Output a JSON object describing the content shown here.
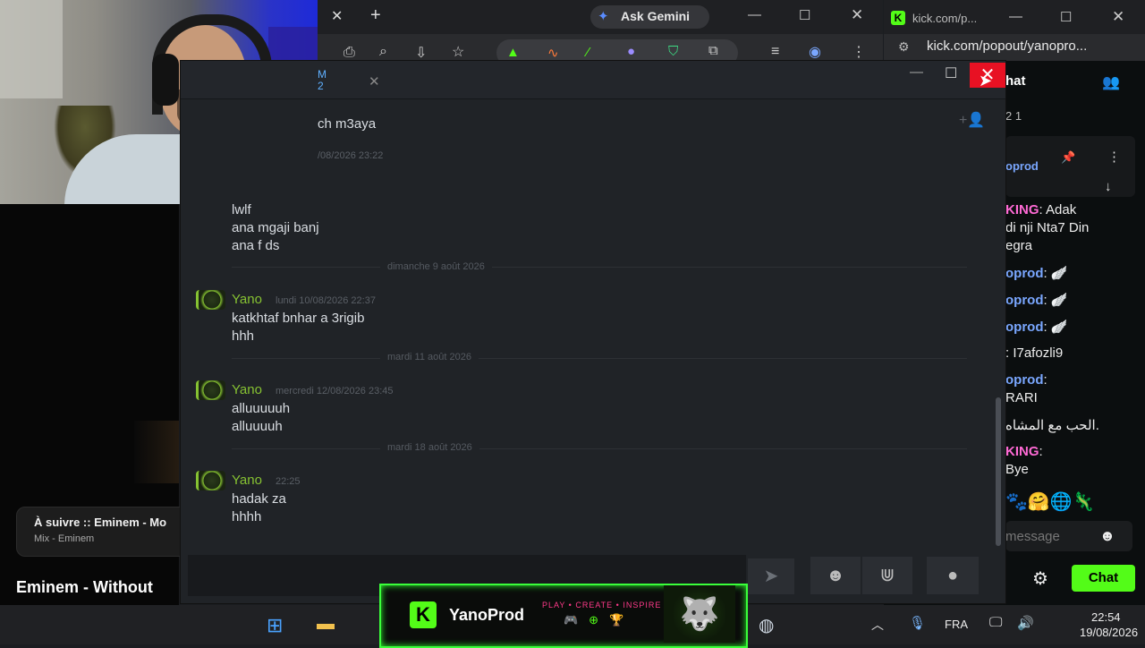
{
  "youtube": {
    "up_next_title": "À suivre :: Eminem - Mo",
    "up_next_subtitle": "Mix - Eminem",
    "video_title": "Eminem - Without"
  },
  "chrome": {
    "tab_close": "✕",
    "new_tab": "+",
    "ask_gemini": "Ask Gemini",
    "min": "—",
    "max": "☐",
    "close": "✕"
  },
  "kick": {
    "logo": "K",
    "tab_title": "kick.com/p...",
    "url": "kick.com/popout/yanopro...",
    "chat_header": "hat",
    "viewer_count": "2 1",
    "pinned_name": "oprod",
    "messages": [
      {
        "name": "KING",
        "name_color": "pink",
        "text": ": Adak"
      },
      {
        "name": "",
        "name_color": "",
        "text": "di nji Nta7 Din"
      },
      {
        "name": "",
        "name_color": "",
        "text": "egra"
      },
      {
        "name": "oprod",
        "name_color": "blue",
        "text": ": 🪽"
      },
      {
        "name": "oprod",
        "name_color": "blue",
        "text": ": 🪽"
      },
      {
        "name": "oprod",
        "name_color": "blue",
        "text": ": 🪽"
      },
      {
        "name": "",
        "name_color": "",
        "text": ": I7afozli9"
      },
      {
        "name": "oprod",
        "name_color": "blue",
        "text": ":"
      },
      {
        "name": "",
        "name_color": "",
        "text": "RARI"
      },
      {
        "name": "",
        "name_color": "",
        "text": "الحب مع المشاه."
      },
      {
        "name": "KING",
        "name_color": "pink",
        "text": ":"
      },
      {
        "name": "",
        "name_color": "",
        "text": "Bye"
      }
    ],
    "emotes": "🐾🤗🌐🦎",
    "input_placeholder": "message",
    "chat_button": "Chat"
  },
  "chat_app": {
    "tab_title_line1": "M",
    "tab_title_line2": "2",
    "tab_close": "✕",
    "partial_top_line": "ch m3aya",
    "partial_ts": "/08/2026 23:22",
    "groups": [
      {
        "lines": [
          "lwlf",
          "ana mgaji banj",
          "ana f ds"
        ]
      }
    ],
    "days": [
      {
        "label": "dimanche 9 août 2026",
        "sender": "Yano",
        "ts": "lundi 10/08/2026 22:37",
        "lines": [
          "katkhtaf bnhar a 3rigib",
          "hhh"
        ]
      },
      {
        "label": "mardi 11 août 2026",
        "sender": "Yano",
        "ts": "mercredi 12/08/2026 23:45",
        "lines": [
          "alluuuuuh",
          "alluuuuh"
        ]
      },
      {
        "label": "mardi 18 août 2026",
        "sender": "Yano",
        "ts": "22:25",
        "lines": [
          "hadak za",
          "hhhh"
        ]
      }
    ],
    "send_icon": "➤",
    "emoji_icon": "☻",
    "attach_icon": "⋓",
    "voice_icon": "●",
    "add_user_icon": "+👤"
  },
  "banner": {
    "k": "K",
    "name": "YanoProd",
    "tagline": "PLAY • CREATE • INSPIRE",
    "icons": "🎮⊕🏆",
    "wolf": "🐺"
  },
  "taskbar": {
    "lang": "FRA",
    "time": "22:54",
    "date": "19/08/2026"
  },
  "colors": {
    "accent_green": "#86c232",
    "kick_green": "#53fc18",
    "close_red": "#e81123"
  }
}
